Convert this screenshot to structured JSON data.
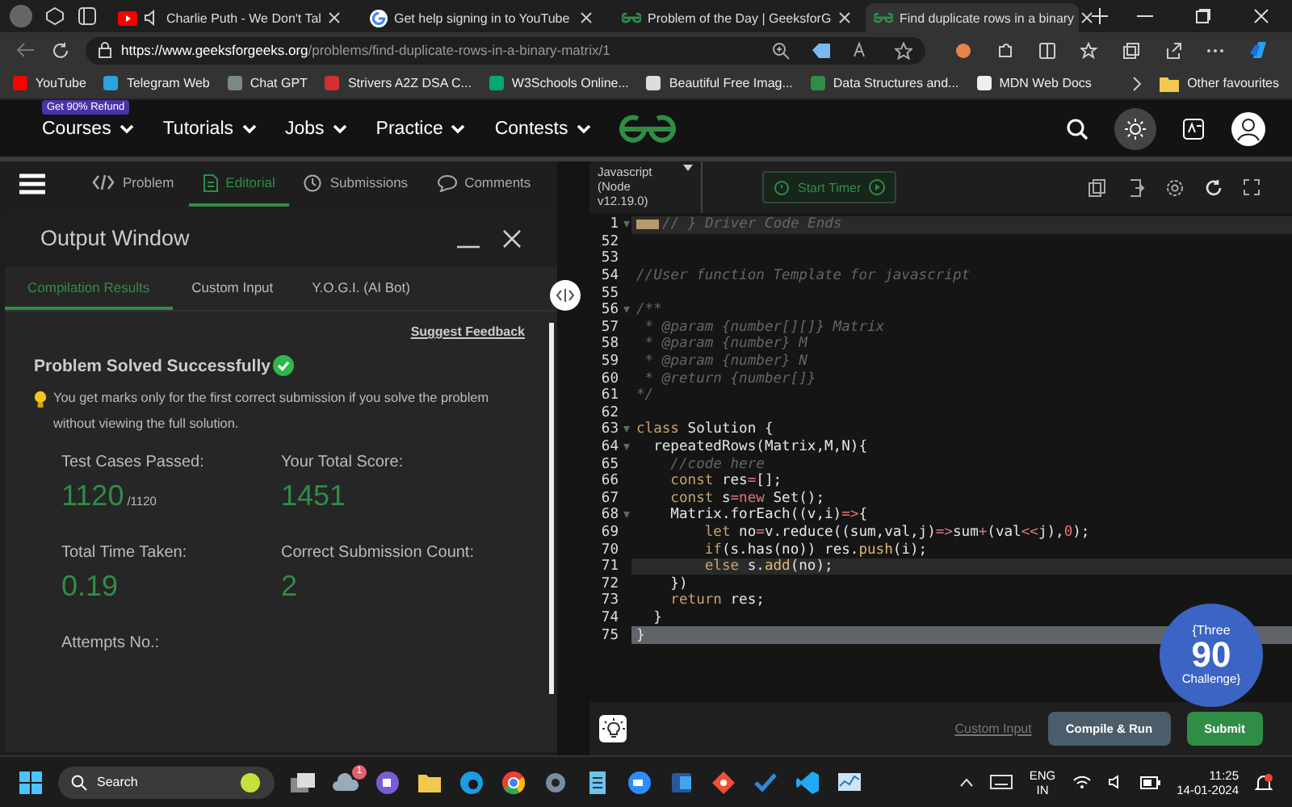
{
  "browser": {
    "tabs": [
      {
        "title": "Charlie Puth - We Don't Tal",
        "kind": "youtube",
        "selected": false
      },
      {
        "title": "Get help signing in to YouTube",
        "kind": "google",
        "selected": false
      },
      {
        "title": "Problem of the Day | GeeksforG",
        "kind": "gfg",
        "selected": false
      },
      {
        "title": "Find duplicate rows in a binary",
        "kind": "gfg",
        "selected": true
      }
    ],
    "url_host": "https://www.geeksforgeeks.org",
    "url_path": "/problems/find-duplicate-rows-in-a-binary-matrix/1",
    "bookmarks": [
      {
        "label": "YouTube",
        "color": "#ff0000"
      },
      {
        "label": "Telegram Web",
        "color": "#2aa3e0"
      },
      {
        "label": "Chat GPT",
        "color": "#7a8a80"
      },
      {
        "label": "Strivers A2Z DSA C...",
        "color": "#d32f2f"
      },
      {
        "label": "W3Schools Online...",
        "color": "#04aa6d"
      },
      {
        "label": "Beautiful Free Imag...",
        "color": "#dddddd"
      },
      {
        "label": "Data Structures and...",
        "color": "#2f8d46"
      },
      {
        "label": "MDN Web Docs",
        "color": "#eeeeee"
      }
    ],
    "other_favourites": "Other favourites"
  },
  "site": {
    "promo": "Get 90% Refund",
    "nav": [
      "Courses",
      "Tutorials",
      "Jobs",
      "Practice",
      "Contests"
    ]
  },
  "panel_tabs": [
    {
      "label": "Problem",
      "kind": "code",
      "selected": false
    },
    {
      "label": "Editorial",
      "kind": "doc",
      "selected": true
    },
    {
      "label": "Submissions",
      "kind": "clock",
      "selected": false
    },
    {
      "label": "Comments",
      "kind": "chat",
      "selected": false
    }
  ],
  "output": {
    "title": "Output Window",
    "tabs": [
      {
        "label": "Compilation Results",
        "selected": true
      },
      {
        "label": "Custom Input",
        "selected": false
      },
      {
        "label": "Y.O.G.I. (AI Bot)",
        "selected": false
      }
    ],
    "suggest": "Suggest Feedback",
    "status": "Problem Solved Successfully",
    "note": "You get marks only for the first correct submission if you solve the problem without viewing the full solution.",
    "stats": [
      {
        "label": "Test Cases Passed:",
        "value": "1120",
        "suffix": "/1120"
      },
      {
        "label": "Your Total Score:",
        "value": "1451"
      },
      {
        "label": "Total Time Taken:",
        "value": "0.19"
      },
      {
        "label": "Correct Submission Count:",
        "value": "2"
      },
      {
        "label": "Attempts No.:"
      }
    ]
  },
  "editor": {
    "language": "Javascript (Node v12.19.0)",
    "timer": "Start Timer",
    "lines": [
      {
        "n": "1",
        "fold": true,
        "highlighted": true,
        "selected": false,
        "folded": true,
        "seg": [
          {
            "text": "// } Driver Code Ends",
            "kind": "comment"
          }
        ]
      },
      {
        "n": "52",
        "fold": false,
        "highlighted": false,
        "selected": false
      },
      {
        "n": "53",
        "fold": false,
        "highlighted": false,
        "selected": false
      },
      {
        "n": "54",
        "fold": false,
        "highlighted": false,
        "selected": false,
        "seg": [
          {
            "text": "//User function Template for javascript",
            "kind": "comment"
          }
        ]
      },
      {
        "n": "55",
        "fold": false,
        "highlighted": false,
        "selected": false
      },
      {
        "n": "56",
        "fold": true,
        "highlighted": false,
        "selected": false,
        "seg": [
          {
            "text": "/**",
            "kind": "comment"
          }
        ]
      },
      {
        "n": "57",
        "fold": false,
        "highlighted": false,
        "selected": false,
        "seg": [
          {
            "text": " * @param {number[][]} Matrix",
            "kind": "comment"
          }
        ]
      },
      {
        "n": "58",
        "fold": false,
        "highlighted": false,
        "selected": false,
        "seg": [
          {
            "text": " * @param {number} M",
            "kind": "comment"
          }
        ]
      },
      {
        "n": "59",
        "fold": false,
        "highlighted": false,
        "selected": false,
        "seg": [
          {
            "text": " * @param {number} N",
            "kind": "comment"
          }
        ]
      },
      {
        "n": "60",
        "fold": false,
        "highlighted": false,
        "selected": false,
        "seg": [
          {
            "text": " * @return {number[]}",
            "kind": "comment"
          }
        ]
      },
      {
        "n": "61",
        "fold": false,
        "highlighted": false,
        "selected": false,
        "seg": [
          {
            "text": "*/",
            "kind": "comment"
          }
        ]
      },
      {
        "n": "62",
        "fold": false,
        "highlighted": false,
        "selected": false
      },
      {
        "n": "63",
        "fold": true,
        "highlighted": false,
        "selected": false,
        "seg": [
          {
            "text": "class",
            "kind": "keyword"
          },
          {
            "text": " Solution {",
            "kind": "plain"
          }
        ]
      },
      {
        "n": "64",
        "fold": true,
        "highlighted": false,
        "selected": false,
        "seg": [
          {
            "text": "  repeatedRows(Matrix,M,N){",
            "kind": "plain"
          }
        ]
      },
      {
        "n": "65",
        "fold": false,
        "highlighted": false,
        "selected": false,
        "seg": [
          {
            "text": "    //code here",
            "kind": "comment"
          }
        ]
      },
      {
        "n": "66",
        "fold": false,
        "highlighted": false,
        "selected": false,
        "seg": [
          {
            "text": "    const",
            "kind": "keyword"
          },
          {
            "text": " res",
            "kind": "plain"
          },
          {
            "text": "=",
            "kind": "operator"
          },
          {
            "text": "[];",
            "kind": "plain"
          }
        ]
      },
      {
        "n": "67",
        "fold": false,
        "highlighted": false,
        "selected": false,
        "seg": [
          {
            "text": "    const",
            "kind": "keyword"
          },
          {
            "text": " s",
            "kind": "plain"
          },
          {
            "text": "=new",
            "kind": "operator"
          },
          {
            "text": " Set();",
            "kind": "plain"
          }
        ]
      },
      {
        "n": "68",
        "fold": true,
        "highlighted": false,
        "selected": false,
        "seg": [
          {
            "text": "    Matrix.forEach((v,i)",
            "kind": "plain"
          },
          {
            "text": "=>",
            "kind": "operator"
          },
          {
            "text": "{",
            "kind": "plain"
          }
        ]
      },
      {
        "n": "69",
        "fold": false,
        "highlighted": false,
        "selected": false,
        "seg": [
          {
            "text": "        let",
            "kind": "keyword"
          },
          {
            "text": " no",
            "kind": "plain"
          },
          {
            "text": "=",
            "kind": "operator"
          },
          {
            "text": "v.reduce((sum,val,j)",
            "kind": "plain"
          },
          {
            "text": "=>",
            "kind": "operator"
          },
          {
            "text": "sum",
            "kind": "plain"
          },
          {
            "text": "+",
            "kind": "operator"
          },
          {
            "text": "(val",
            "kind": "plain"
          },
          {
            "text": "<<",
            "kind": "operator"
          },
          {
            "text": "j),",
            "kind": "plain"
          },
          {
            "text": "0",
            "kind": "number"
          },
          {
            "text": ");",
            "kind": "plain"
          }
        ]
      },
      {
        "n": "70",
        "fold": false,
        "highlighted": false,
        "selected": false,
        "seg": [
          {
            "text": "        if",
            "kind": "keyword"
          },
          {
            "text": "(s.has(no)) res.",
            "kind": "plain"
          },
          {
            "text": "push",
            "kind": "method"
          },
          {
            "text": "(i);",
            "kind": "plain"
          }
        ]
      },
      {
        "n": "71",
        "fold": false,
        "highlighted": true,
        "selected": false,
        "seg": [
          {
            "text": "        else",
            "kind": "keyword"
          },
          {
            "text": " s.",
            "kind": "plain"
          },
          {
            "text": "add",
            "kind": "method"
          },
          {
            "text": "(no);",
            "kind": "plain"
          }
        ]
      },
      {
        "n": "72",
        "fold": false,
        "highlighted": false,
        "selected": false,
        "seg": [
          {
            "text": "    })",
            "kind": "plain"
          }
        ]
      },
      {
        "n": "73",
        "fold": false,
        "highlighted": false,
        "selected": false,
        "seg": [
          {
            "text": "    return",
            "kind": "keyword"
          },
          {
            "text": " res;",
            "kind": "plain"
          }
        ]
      },
      {
        "n": "74",
        "fold": false,
        "highlighted": false,
        "selected": false,
        "seg": [
          {
            "text": "  }",
            "kind": "plain"
          }
        ]
      },
      {
        "n": "75",
        "fold": false,
        "highlighted": false,
        "selected": true,
        "seg": [
          {
            "text": "}",
            "kind": "plain"
          }
        ]
      }
    ],
    "badge": {
      "top": "{Three",
      "num": "90",
      "bottom": "Challenge}"
    },
    "custom_input": "Custom Input",
    "compile": "Compile & Run",
    "submit": "Submit"
  },
  "taskbar": {
    "search": "Search",
    "weather_badge": "1",
    "lang": "ENG",
    "region": "IN",
    "time": "11:25",
    "date": "14-01-2024"
  }
}
